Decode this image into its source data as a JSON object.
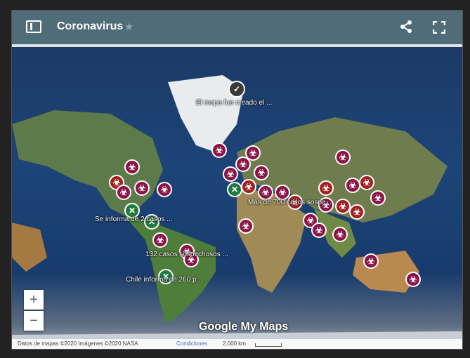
{
  "header": {
    "title": "Coronavirus",
    "icons": [
      "sidebar-toggle-icon",
      "star-icon",
      "share-icon",
      "fullscreen-icon"
    ]
  },
  "map": {
    "labels": [
      "El mapa fue creado el ...",
      "Más de 700 casos sospe...",
      "Se informa de 2 casos ...",
      "132 casos sospechosos ...",
      "Chile informa de 260 p..."
    ],
    "zoom": {
      "in": "+",
      "out": "−"
    },
    "logo": "Google My Maps",
    "attribution": "Datos de mapas ©2020 Imágenes ©2020 NASA",
    "terms": "Condiciones",
    "scale": "2.000 km"
  },
  "colors": {
    "header": "#4f6c78",
    "hazard": "#8a1448",
    "hazard_alt": "#a32020",
    "x_marker": "#1f7a3f"
  }
}
